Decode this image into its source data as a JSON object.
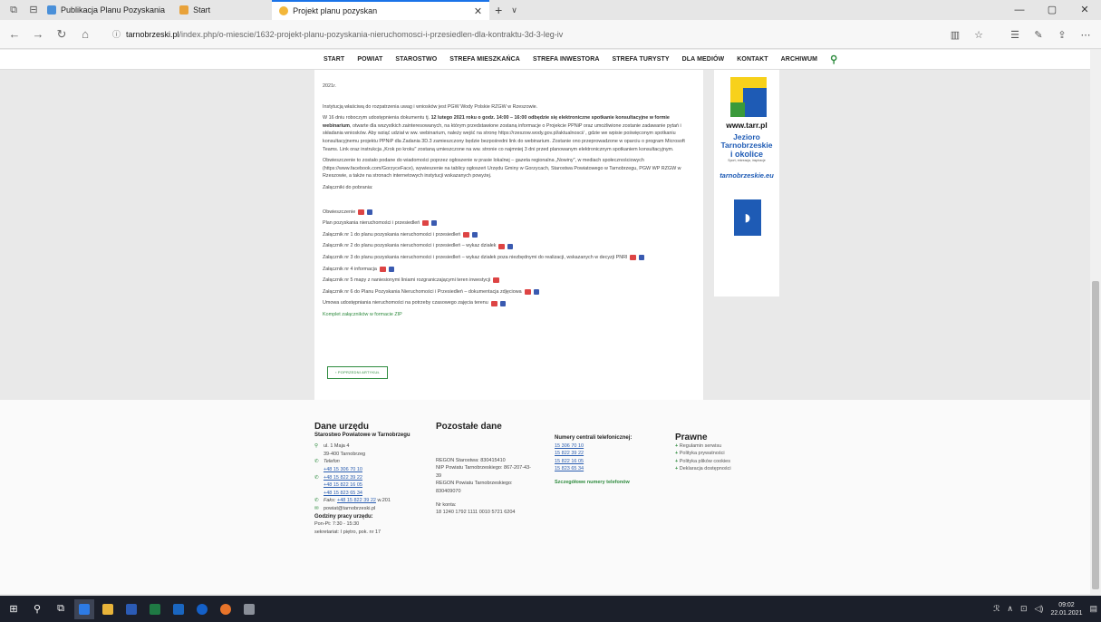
{
  "browser": {
    "tabs": [
      {
        "title": "Publikacja Planu Pozyskania",
        "active": false
      },
      {
        "title": "Start",
        "active": false
      },
      {
        "title": "Projekt planu pozyskan",
        "active": true
      }
    ],
    "url_domain": "tarnobrzeski.pl",
    "url_path": "/index.php/o-miescie/1632-projekt-planu-pozyskania-nieruchomosci-i-przesiedlen-dla-kontraktu-3d-3-leg-iv"
  },
  "site_nav": [
    "START",
    "POWIAT",
    "STAROSTWO",
    "STREFA MIESZKAŃCA",
    "STREFA INWESTORA",
    "STREFA TURYSTY",
    "DLA MEDIÓW",
    "KONTAKT",
    "ARCHIWUM"
  ],
  "article": {
    "top_fragment": "2021r.",
    "p1": "Instytucją właściwą do rozpatrzenia uwag i wniosków jest PGW Wody Polskie RZGW w Rzeszowie.",
    "p2_a": "W 16 dniu roboczym udostępnienia dokumentu tj.",
    "p2_b": "12 lutego 2021 roku o godz. 14:00 – 16:00 odbędzie się elektroniczne spotkanie konsultacyjne w formie webinarium",
    "p2_c": ", otwarte dla wszystkich zainteresowanych, na którym przedstawione zostaną informacje o Projekcie PPNiP oraz umożliwione zostanie zadawanie pytań i składania wniosków. Aby wziąć udział w ww. webinarium, należy wejść na stronę https://rzeszow.wody.gov.pl/aktualnosci/ , gdzie we wpisie poświęconym spotkaniu konsultacyjnemu projektu PPNiP dla Zadania 3D.3 zamieszczony będzie bezpośredni link do webinarium. Zostanie ono przeprowadzone w oparciu o program Microsoft Teams. Link oraz instrukcja „Krok po kroku\" zostaną umieszczone na ww. stronie co najmniej 3 dni przed planowanym elektronicznym spotkaniem konsultacyjnym.",
    "p3": "Obwieszczenie to zostało podane do wiadomości poprzez ogłoszenie w prasie lokalnej – gazeta regionalna „Nowiny\", w mediach społecznościowych (https://www.facebook.com/GorzyceFace), wywieszenie na tablicy ogłoszeń Urzędu Gminy w Gorzycach, Starostwa Powiatowego w Tarnobrzegu, PGW WP RZGW w Rzeszowie, a także na stronach internetowych instytucji wskazanych powyżej.",
    "p4": "Załączniki do pobrania:",
    "attachments": [
      "Obwieszczenie",
      "Plan pozyskania nieruchomości i przesiedleń",
      "Załącznik nr 1 do planu pozyskania nieruchomości i przesiedleń",
      "Załącznik nr 2 do planu pozyskania nieruchomości i przesiedleń – wykaz działek",
      "Załącznik nr 3 do planu pozyskania nieruchomości i przesiedleń – wykaz działek poza niezbędnymi do realizacji, wskazanych w decyzji PNRI",
      "Załącznik nr 4 informacja",
      "Załącznik nr 5 mapy z naniesionymi liniami rozgraniczającymi teren inwestycji",
      "Załącznik nr 6 do Planu Pozyskania Nieruchomości i Przesiedleń – dokumentacja zdjęciowa",
      "Umowa udostępniania nieruchomości na potrzeby czasowego zajęcia terenu"
    ],
    "zip_link": "Komplet załączników w formacie ZIP",
    "prev_button": "‹ POPRZEDNI ARTYKUŁ"
  },
  "sidebar_banners": {
    "tarr": "www.tarr.pl",
    "jeziora_1": "Jezioro",
    "jeziora_2": "Tarnobrzeskie",
    "jeziora_3": "i okolice",
    "jeziora_sub": "Sport, rekreacja, inspiracje",
    "tarnobrzeskie": "tarnobrzeskie.eu"
  },
  "footer": {
    "dane_head": "Dane urzędu",
    "dane_sub": "Starostwo Powiatowe w Tarnobrzegu",
    "address1": "ul. 1 Maja 4",
    "address2": "39-400 Tarnobrzeg",
    "phone_label": "Telefon",
    "phones": [
      "+48 15 306 70 10",
      "+48 15 822 39 22",
      "+48 15 822 16 05",
      "+48 15 823 65 34"
    ],
    "fax_label": "Faks:",
    "fax": "+48 15 822 39 22",
    "fax_ext": "w.201",
    "email": "powiat@tarnobrzeski.pl",
    "hours_head": "Godziny pracy urzędu:",
    "hours": "Pon-Pt: 7:30 - 15:30",
    "secretariat": "sekretariat: I piętro, pok. nr 17",
    "pozostale_head": "Pozostałe dane",
    "regon": "REGON Starostwa: 830415410",
    "nip": "NIP Powiatu Tarnobrzeskiego: 867-207-43-39",
    "regon_powiatu": "REGON Powiatu Tarnobrzeskiego: 830409070",
    "konto_label": "Nr konta:",
    "konto": "18 1240 1792 1111 0010 5721 6204",
    "numery_head": "Numery centrali telefonicznej:",
    "numery": [
      "15 306 70 10",
      "15 822 39 22",
      "15 822 16 05",
      "15 823 65 34"
    ],
    "szczegolowe": "Szczegółowe numery telefonów",
    "prawne_head": "Prawne",
    "prawne_items": [
      "Regulamin serwisu",
      "Polityka prywatności",
      "Polityka plików cookies",
      "Deklaracja dostępności"
    ]
  },
  "taskbar": {
    "time": "09:02",
    "date": "22.01.2021"
  }
}
